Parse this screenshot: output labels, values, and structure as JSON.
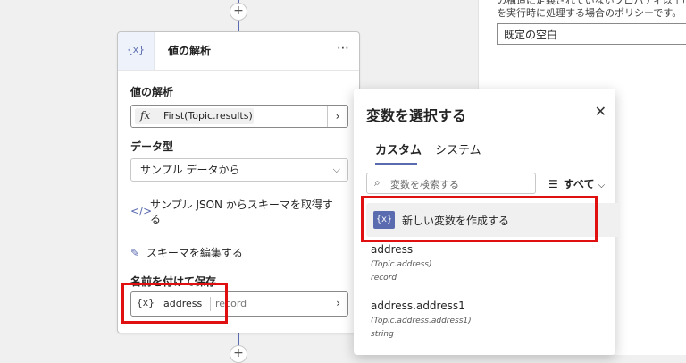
{
  "canvas": {
    "top_plus": "+",
    "bottom_plus": "+"
  },
  "properties_panel": {
    "desc_line1": "の構造に定義されていないプロパティ以上のいい",
    "desc_line2": "を実行時に処理する場合のポリシーです。",
    "policy_value": "既定の空白"
  },
  "node": {
    "icon": "{x}",
    "title": "値の解析",
    "more": "⋯",
    "parse_label": "値の解析",
    "formula": "First(Topic.results)",
    "fx_icon": "fx",
    "datatype_label": "データ型",
    "datatype_value": "サンプル データから",
    "sample_json_line1": "サンプル JSON からスキーマを取得す",
    "sample_json_line2": "る",
    "edit_schema": "スキーマを編集する",
    "save_as_label": "名前を付けて保存",
    "save_icon": "{x}",
    "save_var_name": "address",
    "save_var_type": "record"
  },
  "picker": {
    "title": "変数を選択する",
    "tabs": [
      {
        "label": "カスタム"
      },
      {
        "label": "システム"
      }
    ],
    "search_placeholder": "変数を検索する",
    "filter_label": "すべて",
    "new_var_icon": "{x}",
    "new_var_label": "新しい変数を作成する",
    "variables": [
      {
        "name": "address",
        "path": "(Topic.address)",
        "type": "record"
      },
      {
        "name": "address.address1",
        "path": "(Topic.address.address1)",
        "type": "string"
      }
    ]
  },
  "colors": {
    "accent": "#5b6bb0",
    "highlight": "#e01010"
  }
}
